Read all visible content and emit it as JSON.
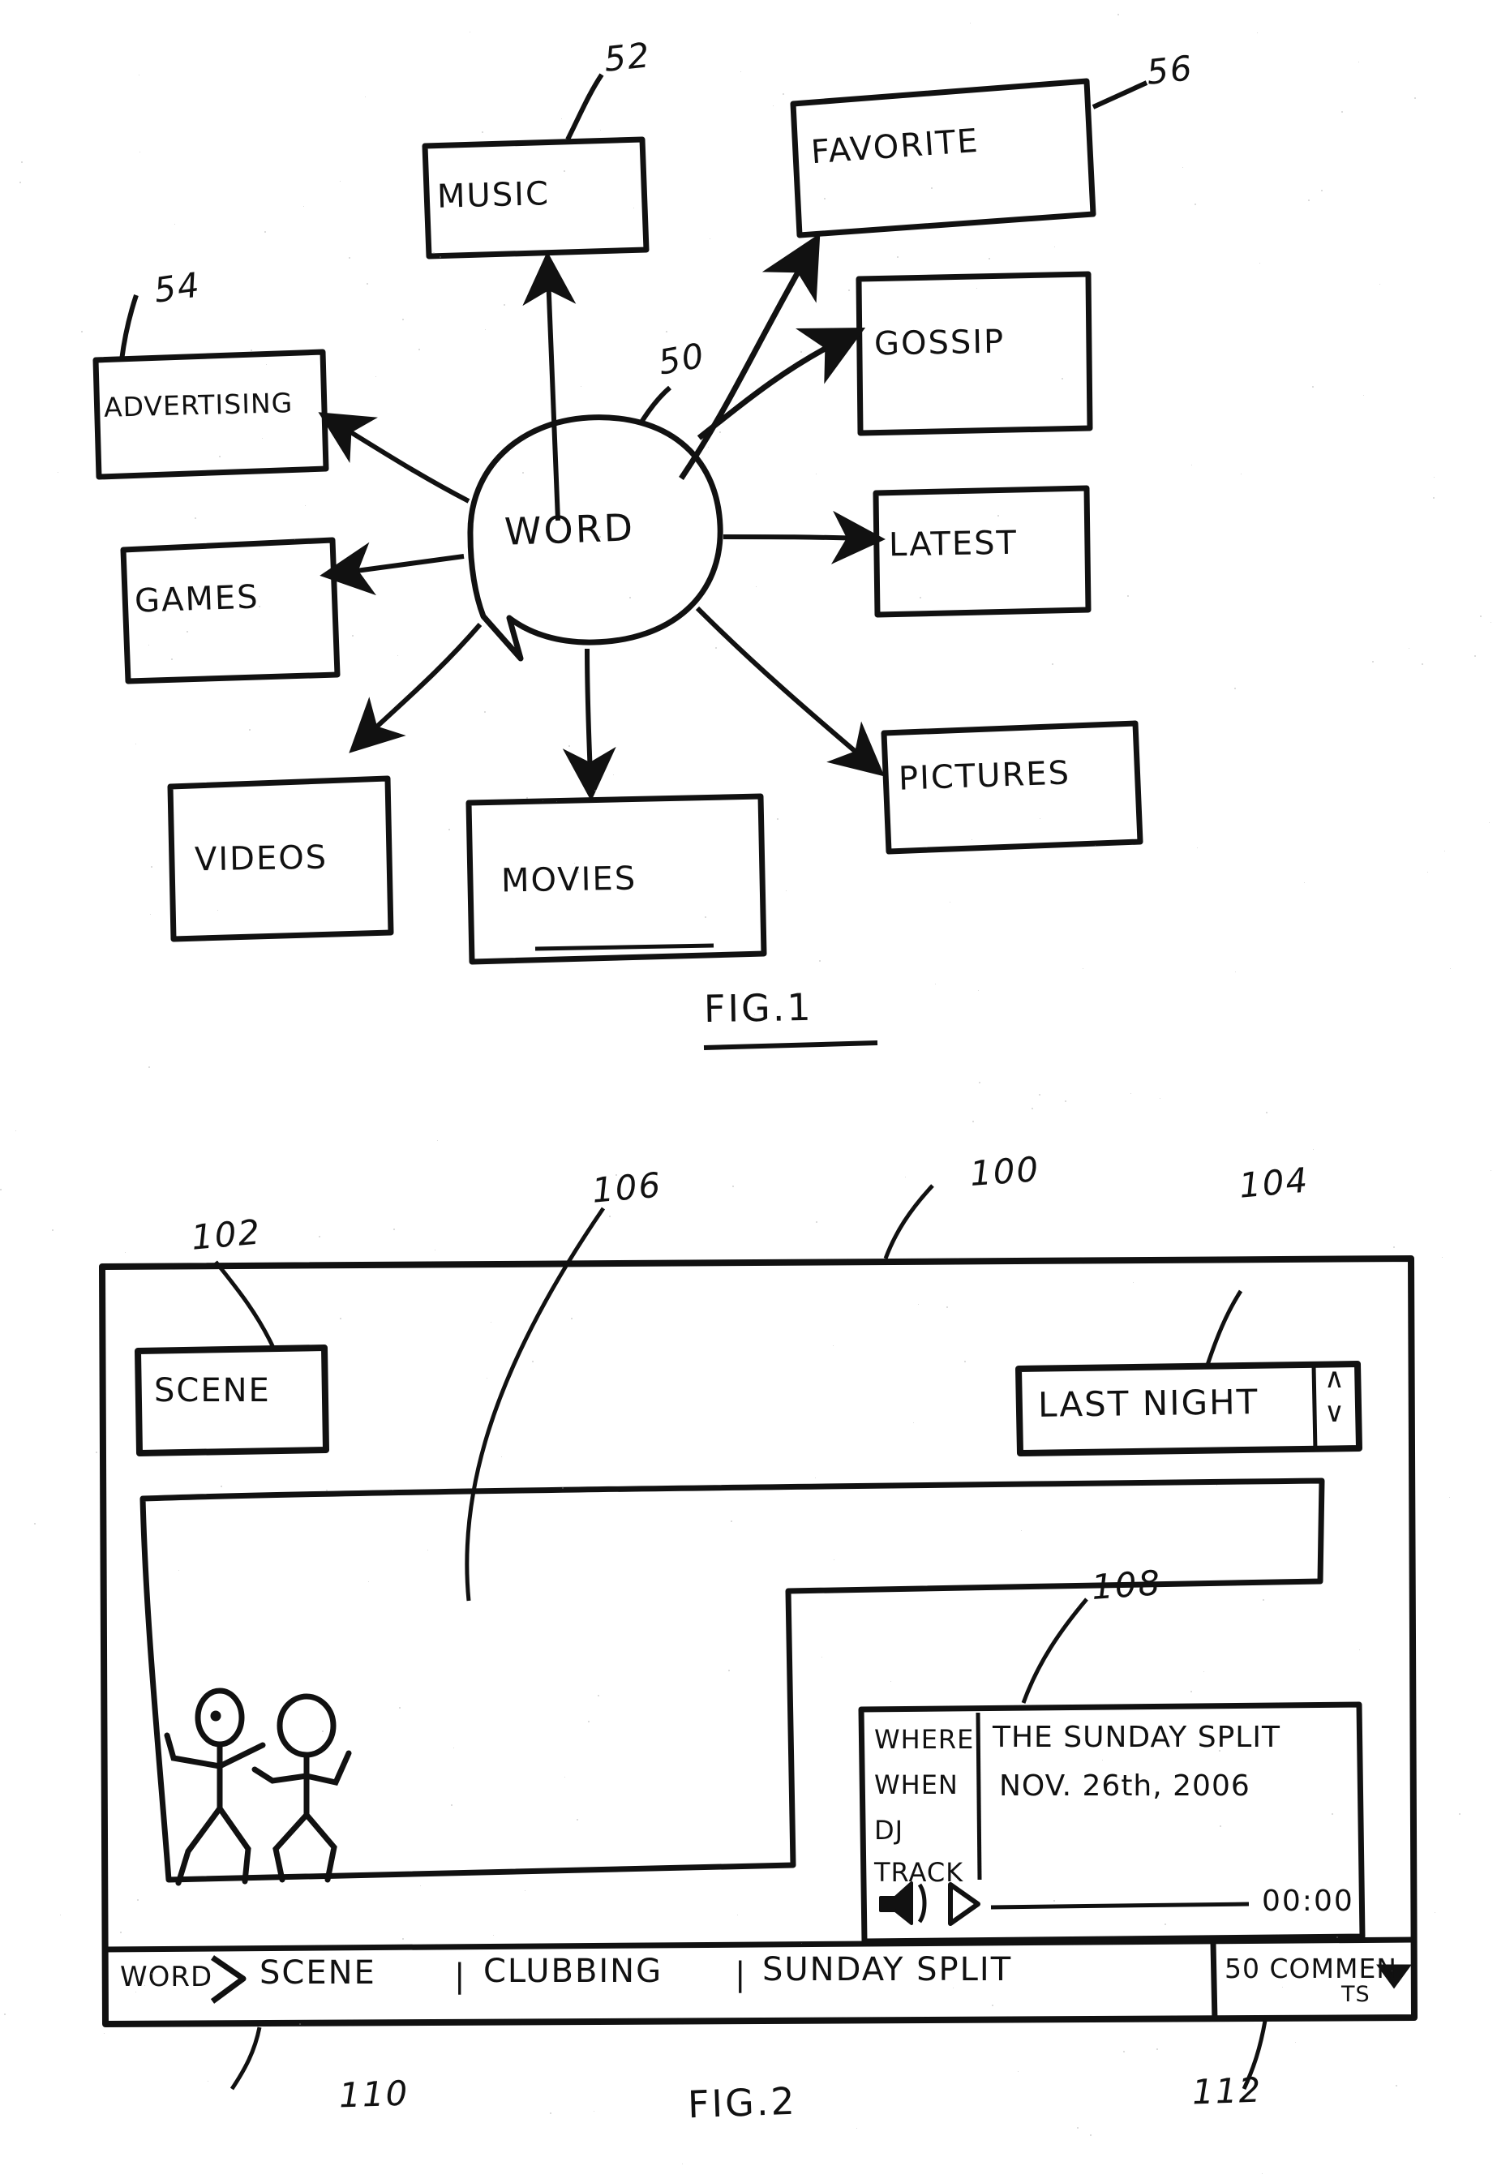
{
  "figure1": {
    "caption": "FIG.1",
    "center": {
      "label": "WORD",
      "ref": "50"
    },
    "nodes": [
      {
        "label": "MUSIC",
        "ref": "52"
      },
      {
        "label": "FAVORITE",
        "ref": "56"
      },
      {
        "label": "ADVERTISING",
        "ref": "54"
      },
      {
        "label": "GOSSIP",
        "ref": ""
      },
      {
        "label": "LATEST",
        "ref": ""
      },
      {
        "label": "GAMES",
        "ref": ""
      },
      {
        "label": "PICTURES",
        "ref": ""
      },
      {
        "label": "VIDEOS",
        "ref": ""
      },
      {
        "label": "MOVIES",
        "ref": ""
      }
    ]
  },
  "figure2": {
    "caption": "FIG.2",
    "screen_ref": "100",
    "scene_button": {
      "label": "SCENE",
      "ref": "102"
    },
    "content_area": {
      "ref": "106"
    },
    "selector": {
      "value": "LAST NIGHT",
      "ref": "104",
      "up": "∧",
      "down": "∨"
    },
    "info_panel": {
      "ref": "108",
      "rows": [
        {
          "label": "WHERE",
          "value": "THE SUNDAY SPLIT"
        },
        {
          "label": "WHEN",
          "value": "NOV. 26th, 2006"
        },
        {
          "label": "DJ",
          "value": ""
        },
        {
          "label": "TRACK",
          "value": ""
        }
      ],
      "player": {
        "volume_icon": "speaker-icon",
        "play_icon": "play-icon",
        "time": "00:00"
      }
    },
    "breadcrumb": {
      "ref": "110",
      "root": "WORD",
      "separator_arrow": ">",
      "items": [
        "SCENE",
        "CLUBBING",
        "SUNDAY SPLIT"
      ],
      "divider": "|"
    },
    "comments": {
      "ref": "112",
      "line1": "50 COMMEN",
      "line2": "TS",
      "caret": "▼"
    },
    "stage": {
      "figures": [
        "dancer-left",
        "dancer-right"
      ]
    }
  }
}
